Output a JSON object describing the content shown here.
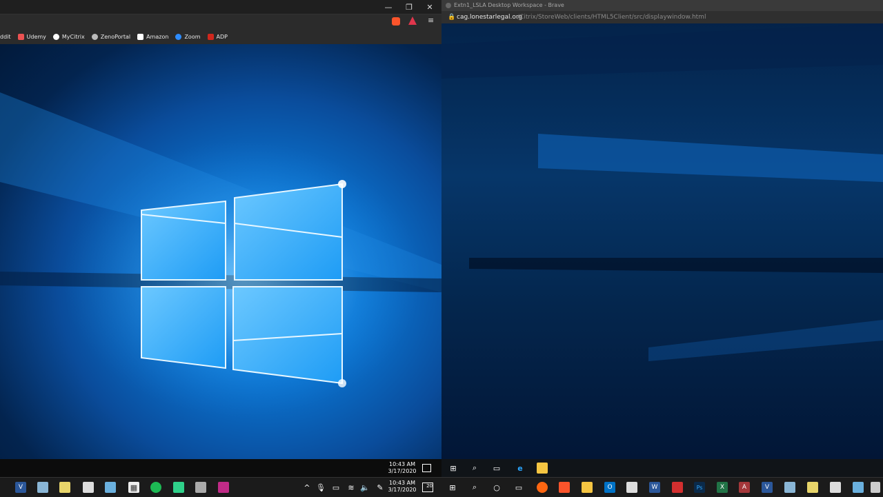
{
  "left_browser": {
    "bookmarks": [
      {
        "label": "ddit",
        "icon": "reddit-icon",
        "color": "#ff4500"
      },
      {
        "label": "Udemy",
        "icon": "udemy-icon",
        "color": "#ec5252"
      },
      {
        "label": "MyCitrix",
        "icon": "citrix-icon",
        "color": "#ffffff"
      },
      {
        "label": "ZenoPortal",
        "icon": "zeno-icon",
        "color": "#bbbbbb"
      },
      {
        "label": "Amazon",
        "icon": "amazon-icon",
        "color": "#ffffff"
      },
      {
        "label": "Zoom",
        "icon": "zoom-icon",
        "color": "#2d8cff"
      },
      {
        "label": "ADP",
        "icon": "adp-icon",
        "color": "#d0271d"
      }
    ],
    "remote_clock": {
      "time": "10:43 AM",
      "date": "3/17/2020"
    }
  },
  "right_browser": {
    "title": "Extn1_LSLA Desktop Workspace - Brave",
    "url_domain": "cag.lonestarlegal.org",
    "url_path": "/Citrix/StoreWeb/clients/HTML5Client/src/displaywindow.html"
  },
  "host_taskbar": {
    "clock": {
      "time": "10:43 AM",
      "date": "3/17/2020"
    },
    "notification_count": "20"
  },
  "colors": {
    "accent": "#0a78d6",
    "taskbar": "#1b1b1b"
  }
}
